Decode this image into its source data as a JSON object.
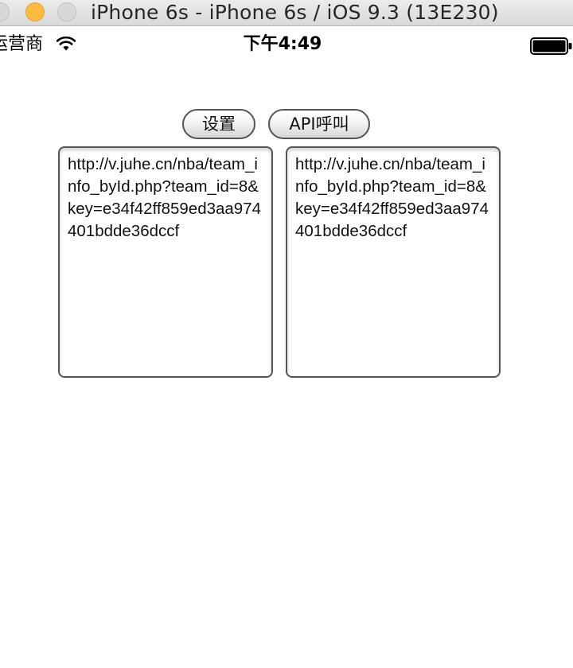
{
  "window": {
    "title": "iPhone 6s - iPhone 6s / iOS 9.3 (13E230)"
  },
  "status_bar": {
    "carrier": "运营商",
    "wifi_icon": "wifi-icon",
    "time": "下午4:49",
    "battery_icon": "battery-icon"
  },
  "buttons": {
    "settings_label": "设置",
    "api_call_label": "API呼叫"
  },
  "panels": {
    "left_text": "http://v.juhe.cn/nba/team_info_byId.php?team_id=8&key=e34f42ff859ed3aa974401bdde36dccf",
    "right_text": "http://v.juhe.cn/nba/team_info_byId.php?team_id=8&key=e34f42ff859ed3aa974401bdde36dccf"
  },
  "colors": {
    "minimize_button": "#fdbc40",
    "border": "#555555"
  }
}
